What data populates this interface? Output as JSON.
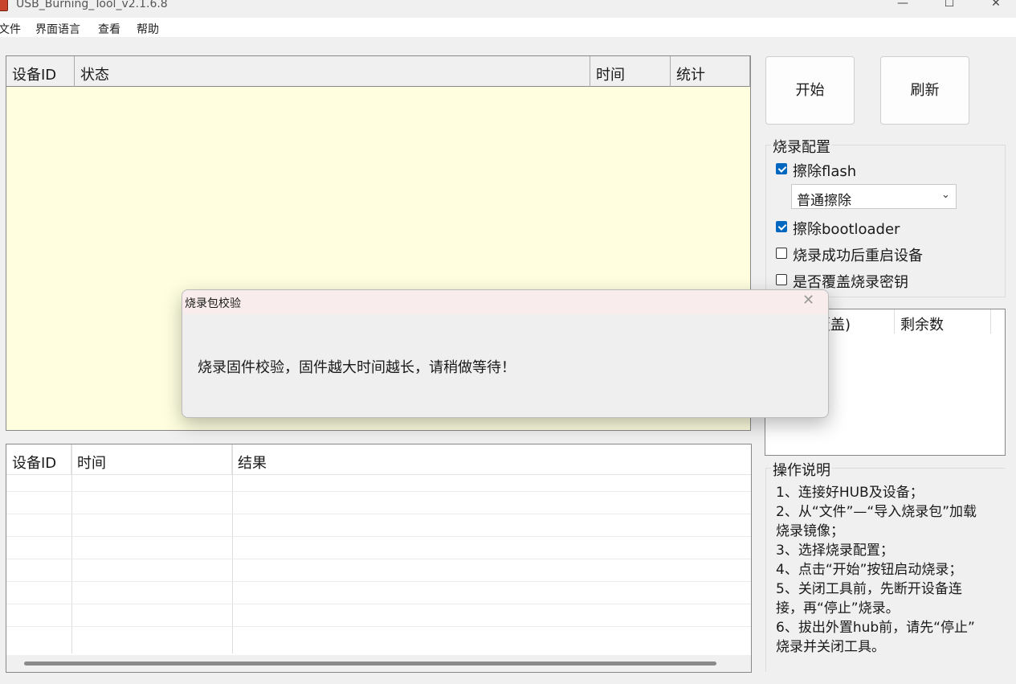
{
  "window": {
    "title": "USB_Burning_Tool_v2.1.6.8",
    "minimize": "—",
    "maximize": "☐",
    "close": "✕",
    "icon": "app-icon"
  },
  "menu": [
    {
      "label": "文件"
    },
    {
      "label": "界面语言"
    },
    {
      "label": "查看"
    },
    {
      "label": "帮助"
    }
  ],
  "device_table": {
    "columns": [
      "设备ID",
      "状态",
      "时间",
      "统计"
    ],
    "bg_color": "#ffffe0"
  },
  "result_table": {
    "columns": [
      "设备ID",
      "时间",
      "结果"
    ]
  },
  "buttons": {
    "start": "开始",
    "refresh": "刷新"
  },
  "burn_config": {
    "title": "烧录配置",
    "erase_flash": {
      "label": "擦除flash",
      "checked": true
    },
    "erase_mode": {
      "value": "普通擦除",
      "icon": "chevron-down-icon"
    },
    "erase_bootloader": {
      "label": "擦除bootloader",
      "checked": true
    },
    "reboot_after": {
      "label": "烧录成功后重启设备",
      "checked": false
    },
    "overwrite_key": {
      "label": "是否覆盖烧录密钥",
      "checked": false
    }
  },
  "key_table": {
    "col1": "否覆盖)",
    "col2": "剩余数"
  },
  "instructions": {
    "title": "操作说明",
    "lines": [
      "1、连接好HUB及设备；",
      "2、从“文件”—“导入烧录包”加载",
      "烧录镜像；",
      "3、选择烧录配置；",
      "4、点击“开始”按钮启动烧录；",
      "5、关闭工具前，先断开设备连",
      "接，再“停止”烧录。",
      "6、拔出外置hub前，请先“停止”",
      "烧录并关闭工具。"
    ]
  },
  "dialog": {
    "title": "烧录包校验",
    "message": "烧录固件校验，固件越大时间越长，请稍做等待！",
    "close": "✕"
  }
}
